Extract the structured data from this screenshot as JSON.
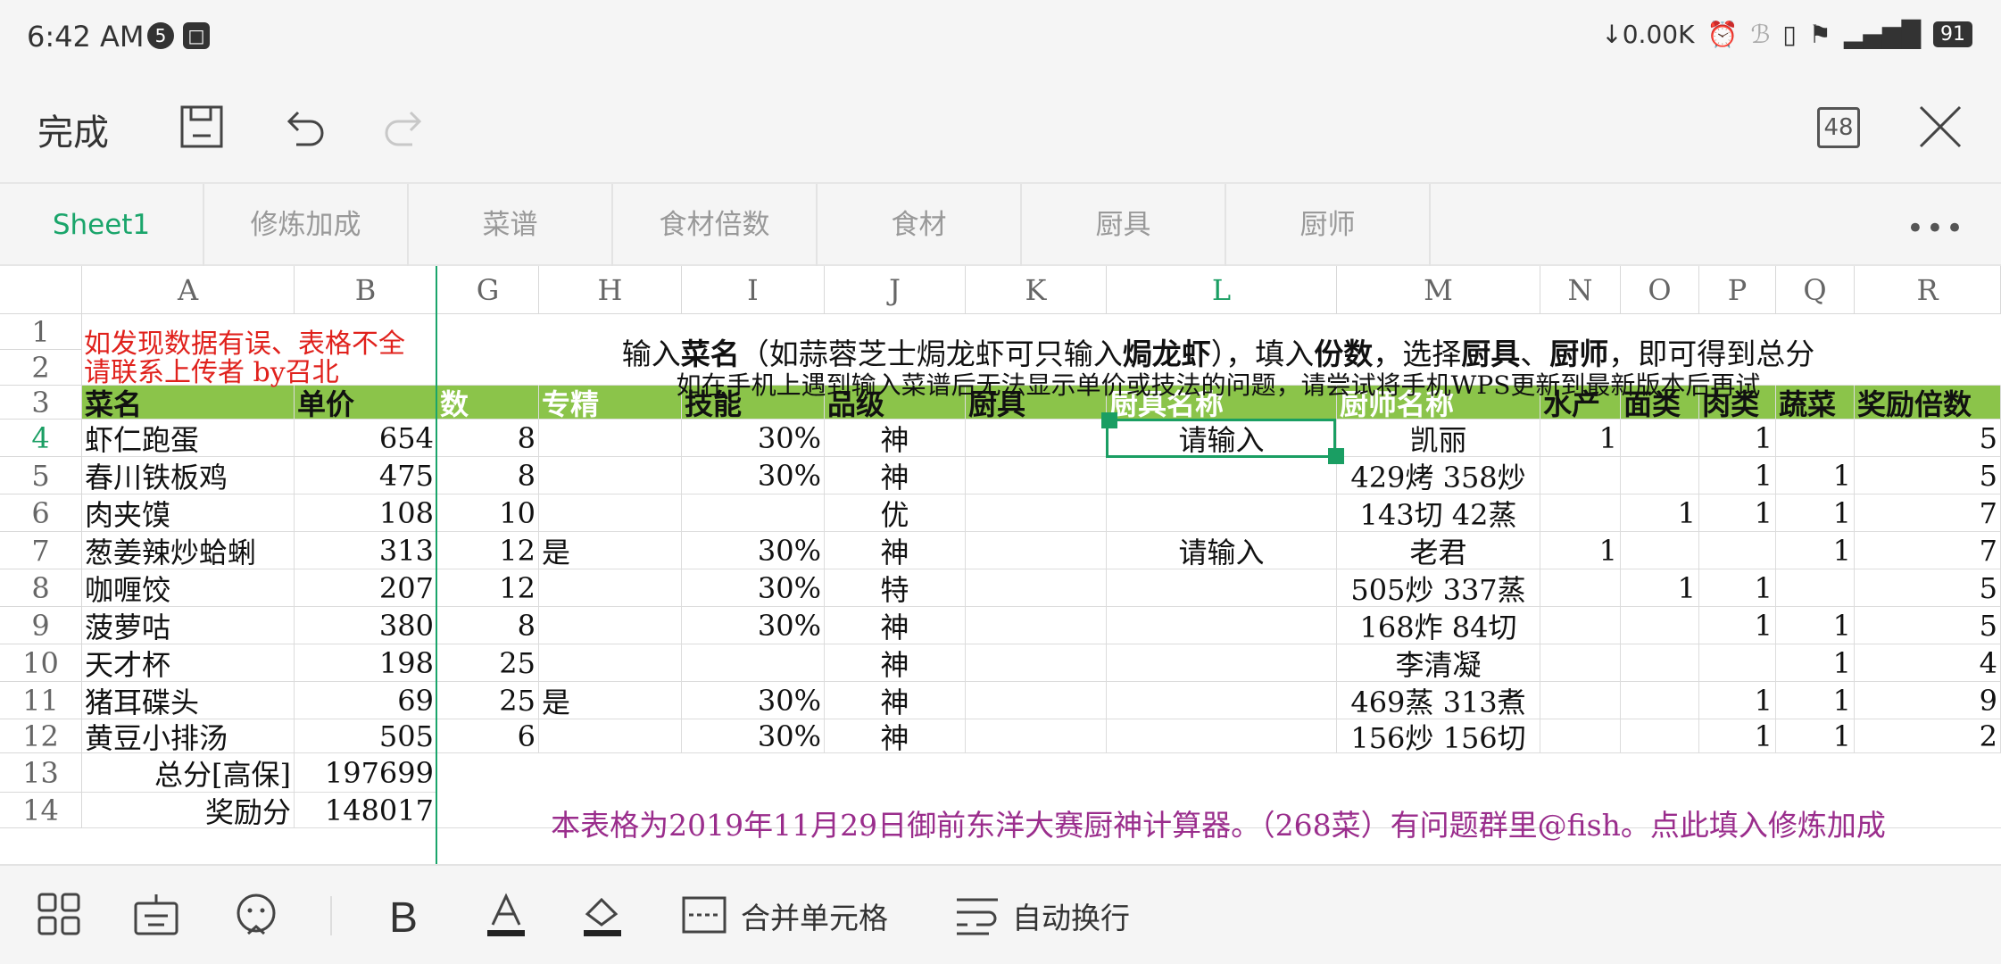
{
  "status_bar": {
    "time": "6:42 AM",
    "notif_count": "5",
    "net_speed": "↓0.00K",
    "battery": "91"
  },
  "toolbar": {
    "done_label": "完成",
    "zoom_level": "48"
  },
  "sheet_tabs": [
    "Sheet1",
    "修炼加成",
    "菜谱",
    "食材倍数",
    "食材",
    "厨具",
    "厨师"
  ],
  "active_tab": "Sheet1",
  "columns": [
    "A",
    "B",
    "G",
    "H",
    "I",
    "J",
    "K",
    "L",
    "M",
    "N",
    "O",
    "P",
    "Q",
    "R"
  ],
  "rows": [
    "1",
    "2",
    "3",
    "4",
    "5",
    "6",
    "7",
    "8",
    "9",
    "10",
    "11",
    "12",
    "13",
    "14"
  ],
  "notes": {
    "red_line1": "如发现数据有误、表格不全",
    "red_line2": "请联系上传者 by召北",
    "hint_parts": [
      "输入",
      "菜名",
      "（如蒜蓉芝士焗龙虾可只输入",
      "焗龙虾",
      "），填入",
      "份数",
      "，选择",
      "厨具",
      "、",
      "厨师",
      "，即可得到总分"
    ],
    "hint2": "如在手机上遇到输入菜谱后无法显示单价或技法的问题，请尝试将手机WPS更新到最新版本后再试",
    "footer": "本表格为2019年11月29日御前东洋大赛厨神计算器。（268菜）有问题群里@fish。点此填入修炼加成"
  },
  "headers": {
    "A": "菜名",
    "B": "单价",
    "G": "数",
    "H": "专精",
    "I": "技能",
    "J": "品级",
    "K": "厨具",
    "L": "厨具名称",
    "M": "厨师名称",
    "N": "水产",
    "O": "面类",
    "P": "肉类",
    "Q": "蔬菜",
    "R": "奖励倍数"
  },
  "table": [
    {
      "A": "虾仁跑蛋",
      "B": "654",
      "G": "8",
      "H": "",
      "I": "30%",
      "J": "神",
      "K": "",
      "L": "请输入",
      "M": "凯丽",
      "N": "1",
      "O": "",
      "P": "1",
      "Q": "",
      "R": "5"
    },
    {
      "A": "春川铁板鸡",
      "B": "475",
      "G": "8",
      "H": "",
      "I": "30%",
      "J": "神",
      "K": "",
      "L": "",
      "M": "429烤 358炒",
      "N": "",
      "O": "",
      "P": "1",
      "Q": "1",
      "R": "5"
    },
    {
      "A": "肉夹馍",
      "B": "108",
      "G": "10",
      "H": "",
      "I": "",
      "J": "优",
      "K": "",
      "L": "",
      "M": "143切 42蒸",
      "N": "",
      "O": "1",
      "P": "1",
      "Q": "1",
      "R": "7"
    },
    {
      "A": "葱姜辣炒蛤蜊",
      "B": "313",
      "G": "12",
      "H": "是",
      "I": "30%",
      "J": "神",
      "K": "",
      "L": "请输入",
      "M": "老君",
      "N": "1",
      "O": "",
      "P": "",
      "Q": "1",
      "R": "7"
    },
    {
      "A": "咖喱饺",
      "B": "207",
      "G": "12",
      "H": "",
      "I": "30%",
      "J": "特",
      "K": "",
      "L": "",
      "M": "505炒 337蒸",
      "N": "",
      "O": "1",
      "P": "1",
      "Q": "",
      "R": "5"
    },
    {
      "A": "菠萝咕",
      "B": "380",
      "G": "8",
      "H": "",
      "I": "30%",
      "J": "神",
      "K": "",
      "L": "",
      "M": "168炸 84切",
      "N": "",
      "O": "",
      "P": "1",
      "Q": "1",
      "R": "5"
    },
    {
      "A": "天才杯",
      "B": "198",
      "G": "25",
      "H": "",
      "I": "",
      "J": "神",
      "K": "",
      "L": "",
      "M": "李清凝",
      "N": "",
      "O": "",
      "P": "",
      "Q": "1",
      "R": "4"
    },
    {
      "A": "猪耳碟头",
      "B": "69",
      "G": "25",
      "H": "是",
      "I": "30%",
      "J": "神",
      "K": "",
      "L": "",
      "M": "469蒸 313煮",
      "N": "",
      "O": "",
      "P": "1",
      "Q": "1",
      "R": "9"
    },
    {
      "A": "黄豆小排汤",
      "B": "505",
      "G": "6",
      "H": "",
      "I": "30%",
      "J": "神",
      "K": "",
      "L": "",
      "M": "156炒 156切",
      "N": "",
      "O": "",
      "P": "1",
      "Q": "1",
      "R": "2"
    }
  ],
  "totals": {
    "score_label": "总分[高保]",
    "score_value": "197699",
    "bonus_label": "奖励分",
    "bonus_value": "148017"
  },
  "bottom_bar": {
    "merge_label": "合并单元格",
    "wrap_label": "自动换行"
  }
}
